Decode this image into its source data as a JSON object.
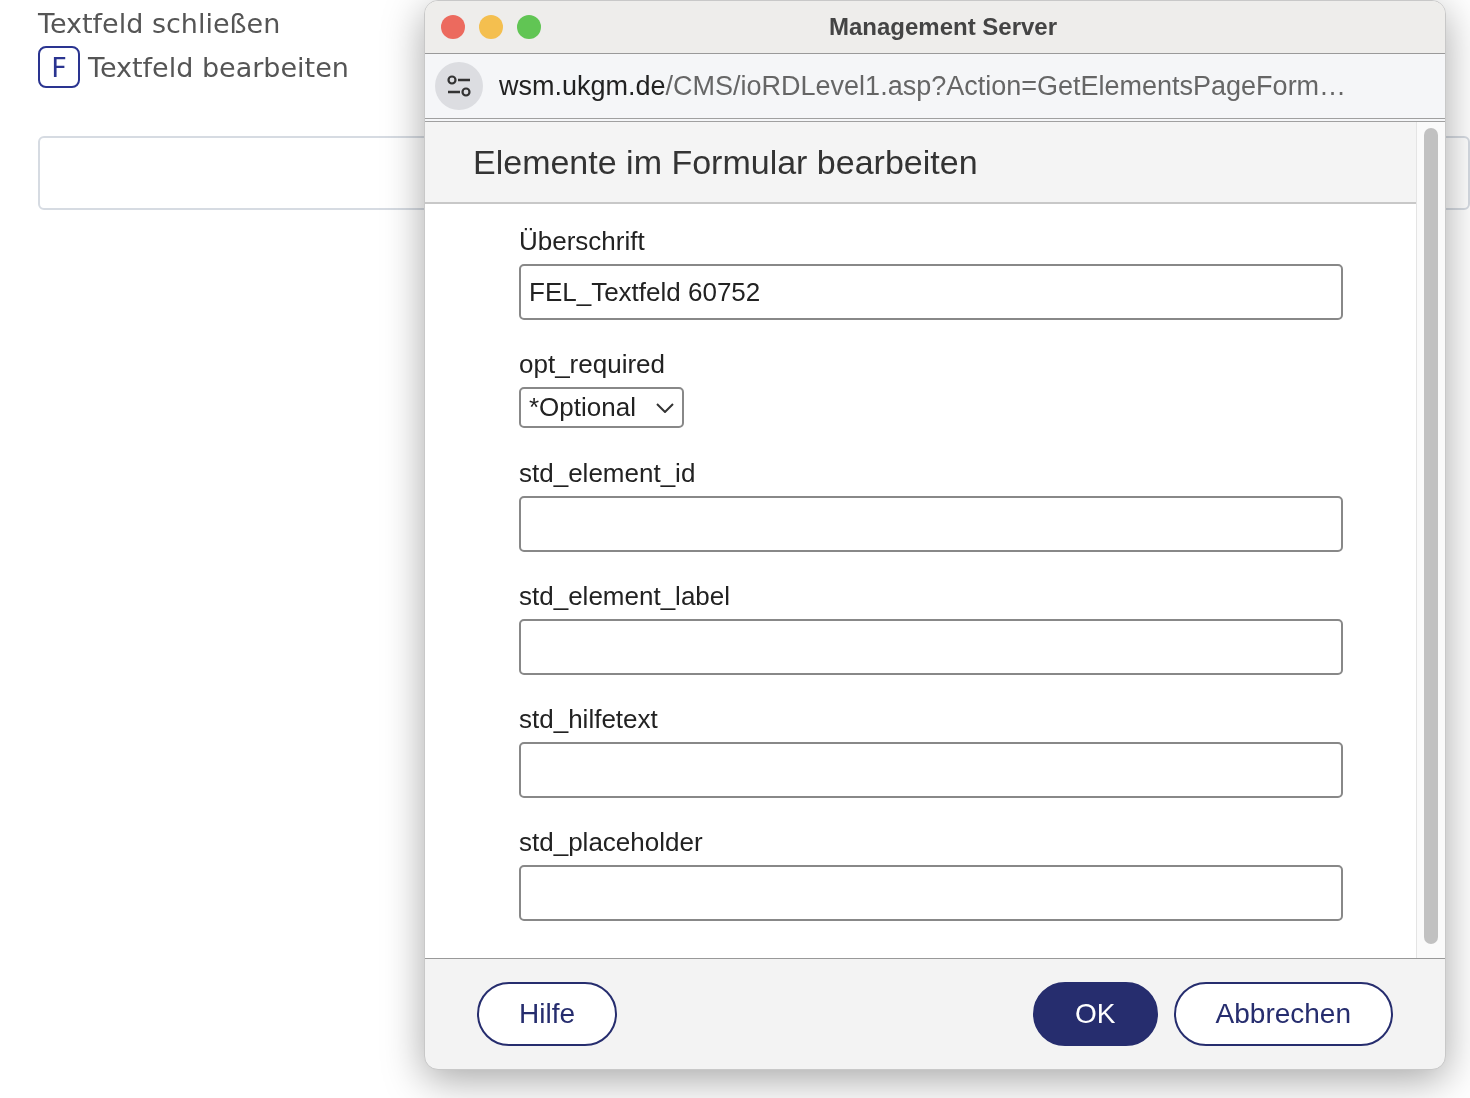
{
  "page": {
    "close_link": "Textfeld schließen",
    "edit_badge": "F",
    "edit_link": "Textfeld bearbeiten"
  },
  "window": {
    "title": "Management Server",
    "url_host": "wsm.ukgm.de",
    "url_path": "/CMS/ioRDLevel1.asp?Action=GetElementsPageForm…"
  },
  "dialog": {
    "heading": "Elemente im Formular bearbeiten",
    "fields": [
      {
        "kind": "text",
        "label": "Überschrift",
        "value": "FEL_Textfeld 60752"
      },
      {
        "kind": "select",
        "label": "opt_required",
        "value": "*Optional"
      },
      {
        "kind": "text",
        "label": "std_element_id"
      },
      {
        "kind": "text",
        "label": "std_element_label"
      },
      {
        "kind": "text",
        "label": "std_hilfetext"
      },
      {
        "kind": "text",
        "label": "std_placeholder"
      }
    ],
    "buttons": [
      {
        "label": "Hilfe",
        "primary": false
      },
      {
        "label": "OK",
        "primary": true
      },
      {
        "label": "Abbrechen",
        "primary": false
      }
    ]
  }
}
